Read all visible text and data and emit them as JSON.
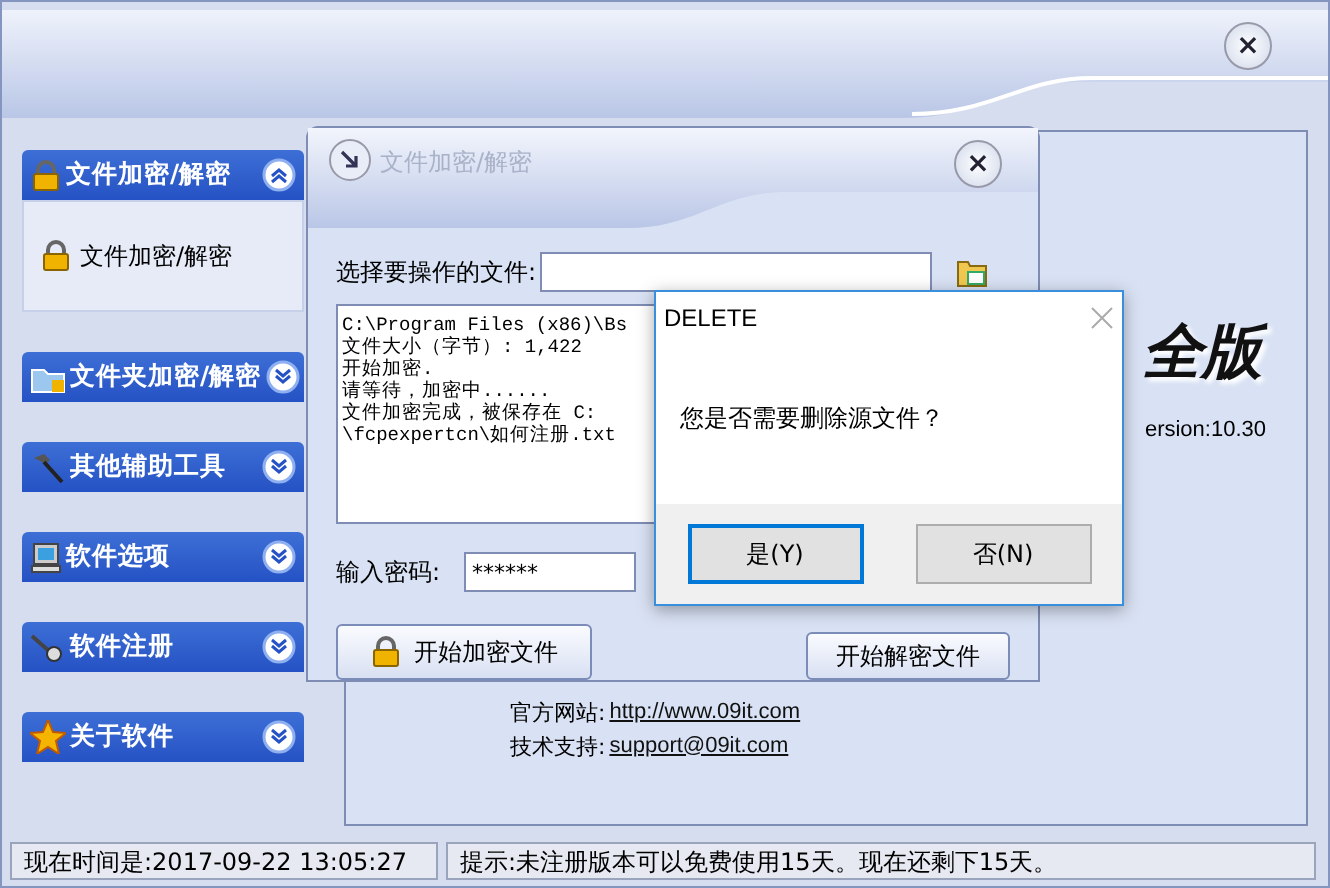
{
  "main_window": {
    "close_label": "×"
  },
  "sidebar": {
    "groups": [
      {
        "label": "文件加密/解密",
        "expanded": true,
        "items": [
          {
            "label": "文件加密/解密"
          }
        ]
      },
      {
        "label": "文件夹加密/解密",
        "expanded": false
      },
      {
        "label": "其他辅助工具",
        "expanded": false
      },
      {
        "label": "软件选项",
        "expanded": false
      },
      {
        "label": "软件注册",
        "expanded": false
      },
      {
        "label": "关于软件",
        "expanded": false
      }
    ]
  },
  "about_panel": {
    "logo_text": "全版",
    "version": "ersion:10.30",
    "links": [
      {
        "label": "官方网站:",
        "url": "http://www.09it.com"
      },
      {
        "label": "技术支持:",
        "url": "support@09it.com"
      }
    ]
  },
  "encrypt_window": {
    "title": "文件加密/解密",
    "close_label": "×",
    "file_label": "选择要操作的文件:",
    "log_lines": [
      "C:\\Program Files (x86)\\Bs",
      "文件大小（字节）: 1,422",
      "开始加密.",
      "请等待，加密中......",
      "文件加密完成，被保存在 C:",
      "\\fcpexpertcn\\如何注册.txt"
    ],
    "password_label": "输入密码:",
    "password_value": "******",
    "encrypt_button": "开始加密文件",
    "decrypt_button": "开始解密文件"
  },
  "dialog": {
    "title": "DELETE",
    "message": "您是否需要删除源文件？",
    "buttons": [
      {
        "label": "是(Y)",
        "focused": true
      },
      {
        "label": "否(N)",
        "focused": false
      }
    ]
  },
  "status_bar": [
    "现在时间是:2017-09-22 13:05:27",
    "提示:未注册版本可以免费使用15天。现在还剩下15天。"
  ]
}
